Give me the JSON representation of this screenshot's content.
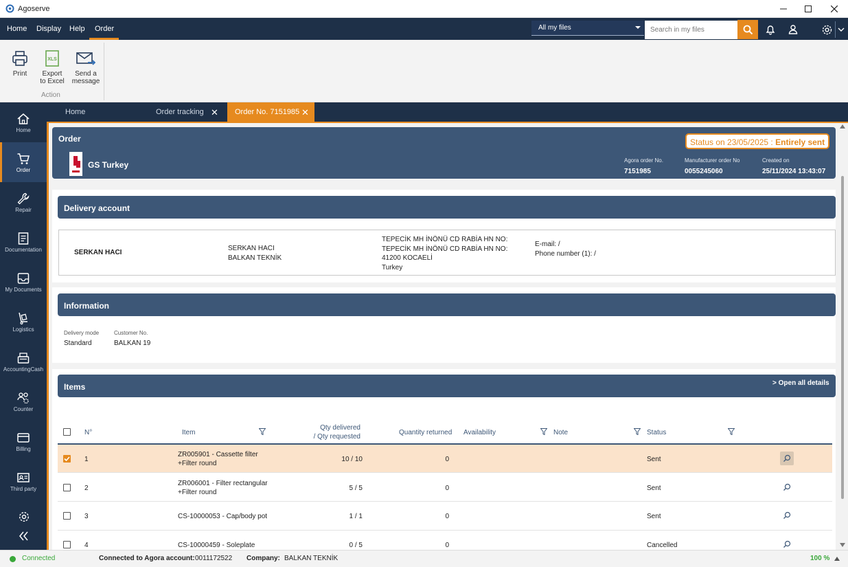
{
  "window": {
    "title": "Agoserve"
  },
  "menu": {
    "items": [
      "Home",
      "Display",
      "Help",
      "Order"
    ],
    "active": "Order"
  },
  "search": {
    "scope": "All my files",
    "placeholder": "Search in my files"
  },
  "ribbon": {
    "buttons": [
      {
        "line1": "Print",
        "line2": "",
        "icon": "printer-icon"
      },
      {
        "line1": "Export",
        "line2": "to Excel",
        "icon": "xls-icon"
      },
      {
        "line1": "Send a",
        "line2": "message",
        "icon": "envelope-icon"
      }
    ],
    "group_label": "Action"
  },
  "sidebar": {
    "items": [
      {
        "label": "Home",
        "icon": "home-icon"
      },
      {
        "label": "Order",
        "icon": "cart-icon",
        "active": true
      },
      {
        "label": "Repair",
        "icon": "wrench-icon"
      },
      {
        "label": "Documentation",
        "icon": "document-icon"
      },
      {
        "label": "My Documents",
        "icon": "inbox-icon"
      },
      {
        "label": "Logistics",
        "icon": "hand-truck-icon"
      },
      {
        "label": "AccountingCash",
        "icon": "cash-register-icon"
      },
      {
        "label": "Counter",
        "icon": "users-gear-icon"
      },
      {
        "label": "Billing",
        "icon": "card-icon"
      },
      {
        "label": "Third party",
        "icon": "id-card-icon"
      }
    ]
  },
  "tabs": [
    {
      "label": "Home"
    },
    {
      "label": "Order tracking",
      "closable": true
    },
    {
      "label": "Order No. 7151985",
      "closable": true,
      "active": true
    }
  ],
  "order": {
    "title": "Order",
    "brand": "GS Turkey",
    "status_prefix": "Status on 23/05/2025 : ",
    "status_value": "Entirely sent",
    "agora_label": "Agora order No.",
    "agora_value": "7151985",
    "manufacturer_label": "Manufacturer order No",
    "manufacturer_value": "0055245060",
    "created_label": "Created on",
    "created_value": "25/11/2024 13:43:07"
  },
  "delivery": {
    "title": "Delivery account",
    "name": "SERKAN HACI",
    "contact_line1": "SERKAN HACI",
    "contact_line2": "BALKAN TEKNİK",
    "address_line1": "TEPECİK MH İNÖNÜ CD RABİA HN NO:",
    "address_line2": "TEPECİK MH İNÖNÜ CD RABİA HN NO:",
    "address_line3": "41200 KOCAELİ",
    "address_line4": "Turkey",
    "email": "E-mail: /",
    "phone": "Phone number (1): /"
  },
  "information": {
    "title": "Information",
    "delivery_mode_label": "Delivery mode",
    "delivery_mode_value": "Standard",
    "customer_no_label": "Customer No.",
    "customer_no_value": "BALKAN 19"
  },
  "items": {
    "title": "Items",
    "open_all": ">  Open all details",
    "columns": {
      "no": "N°",
      "item": "Item",
      "qty_line1": "Qty delivered",
      "qty_line2": "/ Qty requested",
      "returned": "Quantity returned",
      "availability": "Availability",
      "note": "Note",
      "status": "Status"
    },
    "rows": [
      {
        "no": "1",
        "item_line1": "ZR005901 - Cassette filter",
        "item_line2": "+Filter round",
        "qty": "10 /  10",
        "returned": "0",
        "status": "Sent",
        "checked": true
      },
      {
        "no": "2",
        "item_line1": "ZR006001 - Filter rectangular",
        "item_line2": "+Filter round",
        "qty": "5 /  5",
        "returned": "0",
        "status": "Sent",
        "checked": false
      },
      {
        "no": "3",
        "item_line1": "CS-10000053 - Cap/body pot",
        "item_line2": "",
        "qty": "1 /  1",
        "returned": "0",
        "status": "Sent",
        "checked": false
      },
      {
        "no": "4",
        "item_line1": "CS-10000459 - Soleplate",
        "item_line2": "",
        "qty": "0 /  5",
        "returned": "0",
        "status": "Cancelled",
        "checked": false
      }
    ]
  },
  "statusbar": {
    "connection": "Connected",
    "account_label": "Connected to Agora account:",
    "account_value": "0011172522",
    "company_label": "Company:",
    "company_value": "BALKAN TEKNİK",
    "zoom": "100 %"
  },
  "colors": {
    "navy": "#1e3048",
    "panel": "#3d5777",
    "accent": "#e68a1f",
    "connected": "#3aa83a"
  }
}
